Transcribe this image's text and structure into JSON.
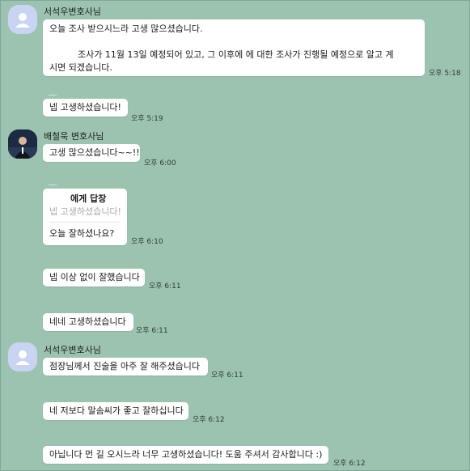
{
  "messages": [
    {
      "sender": "서석우변호사님",
      "lines": [
        "오늘 조사 받으시느라 고생 많으셨습니다.",
        "조사가 11월 13일 예정되어 있고, 그 이후에          에 대한 조사가 진행될 예정으로 알고 계",
        "시면 되겠습니다."
      ],
      "time": "오후 5:18"
    },
    {
      "text": "넵 고생하셨습니다!",
      "time": "오후 5:19"
    },
    {
      "sender": "배철욱 변호사님",
      "text": "고생 많으셨습니다~~!!",
      "time": "오후 6:00"
    },
    {
      "reply_header": "에게 답장",
      "reply_quote": "넵 고생하셨습니다!",
      "text": "오늘 잘하셨나요?",
      "time": "오후 6:10"
    },
    {
      "text": "넵 이상 없이 잘했습니다",
      "time": "오후 6:11"
    },
    {
      "text": "네네 고생하셨습니다",
      "time": "오후 6:11"
    },
    {
      "sender": "서석우변호사님",
      "text": "점장님께서 진술을 아주 잘 해주셨습니다",
      "time": "오후 6:11"
    },
    {
      "text": "네 저보다 말솜씨가 좋고 잘하십니다",
      "time": "오후 6:12"
    },
    {
      "text": "아닙니다 먼 길 오시느라 너무 고생하셨습니다! 도움 주셔서 감사합니다 :)",
      "time": "오후 6:12"
    }
  ],
  "colors": {
    "background": "#9bc3b0",
    "bubble": "#ffffff",
    "avatar_default": "#c9d3f2"
  },
  "icons": [
    "user-avatar-icon",
    "profile-photo-icon"
  ]
}
